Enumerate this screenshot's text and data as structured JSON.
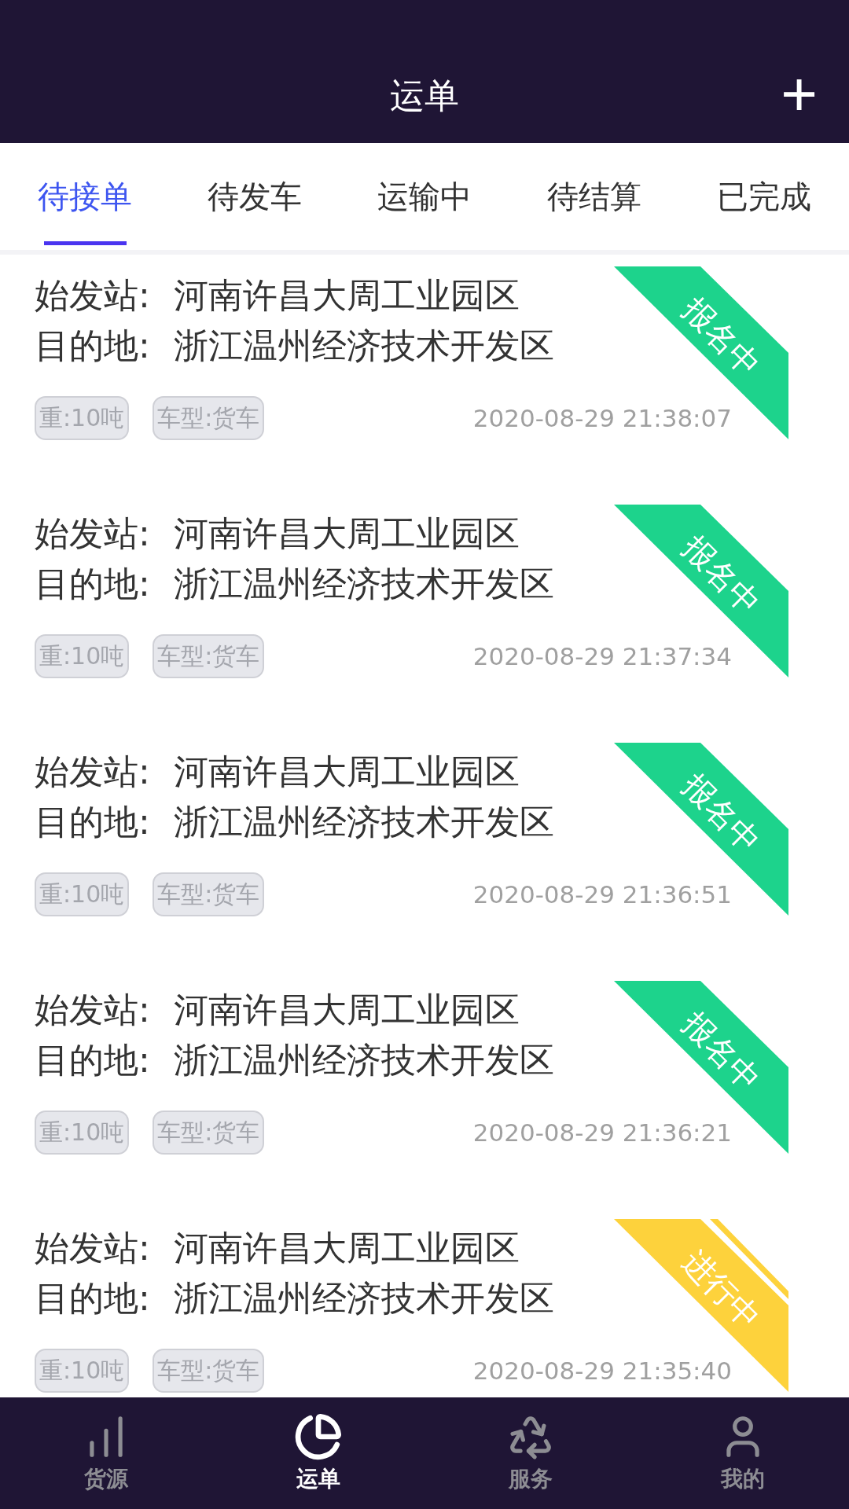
{
  "header": {
    "title": "运单",
    "add_button": "+"
  },
  "tabs": [
    {
      "label": "待接单",
      "selected": true
    },
    {
      "label": "待发车",
      "selected": false
    },
    {
      "label": "运输中",
      "selected": false
    },
    {
      "label": "待结算",
      "selected": false
    },
    {
      "label": "已完成",
      "selected": false
    }
  ],
  "orders": [
    {
      "origin_label": "始发站:",
      "origin": "河南许昌大周工业园区",
      "destination_label": "目的地:",
      "destination": "浙江温州经济技术开发区",
      "tags": [
        "重:10吨",
        "车型:货车"
      ],
      "time": "2020-08-29 21:38:07",
      "status": {
        "label": "报名中",
        "color": "#1dd38c",
        "striped": false
      }
    },
    {
      "origin_label": "始发站:",
      "origin": "河南许昌大周工业园区",
      "destination_label": "目的地:",
      "destination": "浙江温州经济技术开发区",
      "tags": [
        "重:10吨",
        "车型:货车"
      ],
      "time": "2020-08-29 21:37:34",
      "status": {
        "label": "报名中",
        "color": "#1dd38c",
        "striped": false
      }
    },
    {
      "origin_label": "始发站:",
      "origin": "河南许昌大周工业园区",
      "destination_label": "目的地:",
      "destination": "浙江温州经济技术开发区",
      "tags": [
        "重:10吨",
        "车型:货车"
      ],
      "time": "2020-08-29 21:36:51",
      "status": {
        "label": "报名中",
        "color": "#1dd38c",
        "striped": false
      }
    },
    {
      "origin_label": "始发站:",
      "origin": "河南许昌大周工业园区",
      "destination_label": "目的地:",
      "destination": "浙江温州经济技术开发区",
      "tags": [
        "重:10吨",
        "车型:货车"
      ],
      "time": "2020-08-29 21:36:21",
      "status": {
        "label": "报名中",
        "color": "#1dd38c",
        "striped": false
      }
    },
    {
      "origin_label": "始发站:",
      "origin": "河南许昌大周工业园区",
      "destination_label": "目的地:",
      "destination": "浙江温州经济技术开发区",
      "tags": [
        "重:10吨",
        "车型:货车"
      ],
      "time": "2020-08-29 21:35:40",
      "status": {
        "label": "进行中",
        "color": "#fdd23c",
        "striped": true
      }
    }
  ],
  "bottom_nav": [
    {
      "label": "货源",
      "selected": false
    },
    {
      "label": "运单",
      "selected": true
    },
    {
      "label": "服务",
      "selected": false
    },
    {
      "label": "我的",
      "selected": false
    }
  ]
}
